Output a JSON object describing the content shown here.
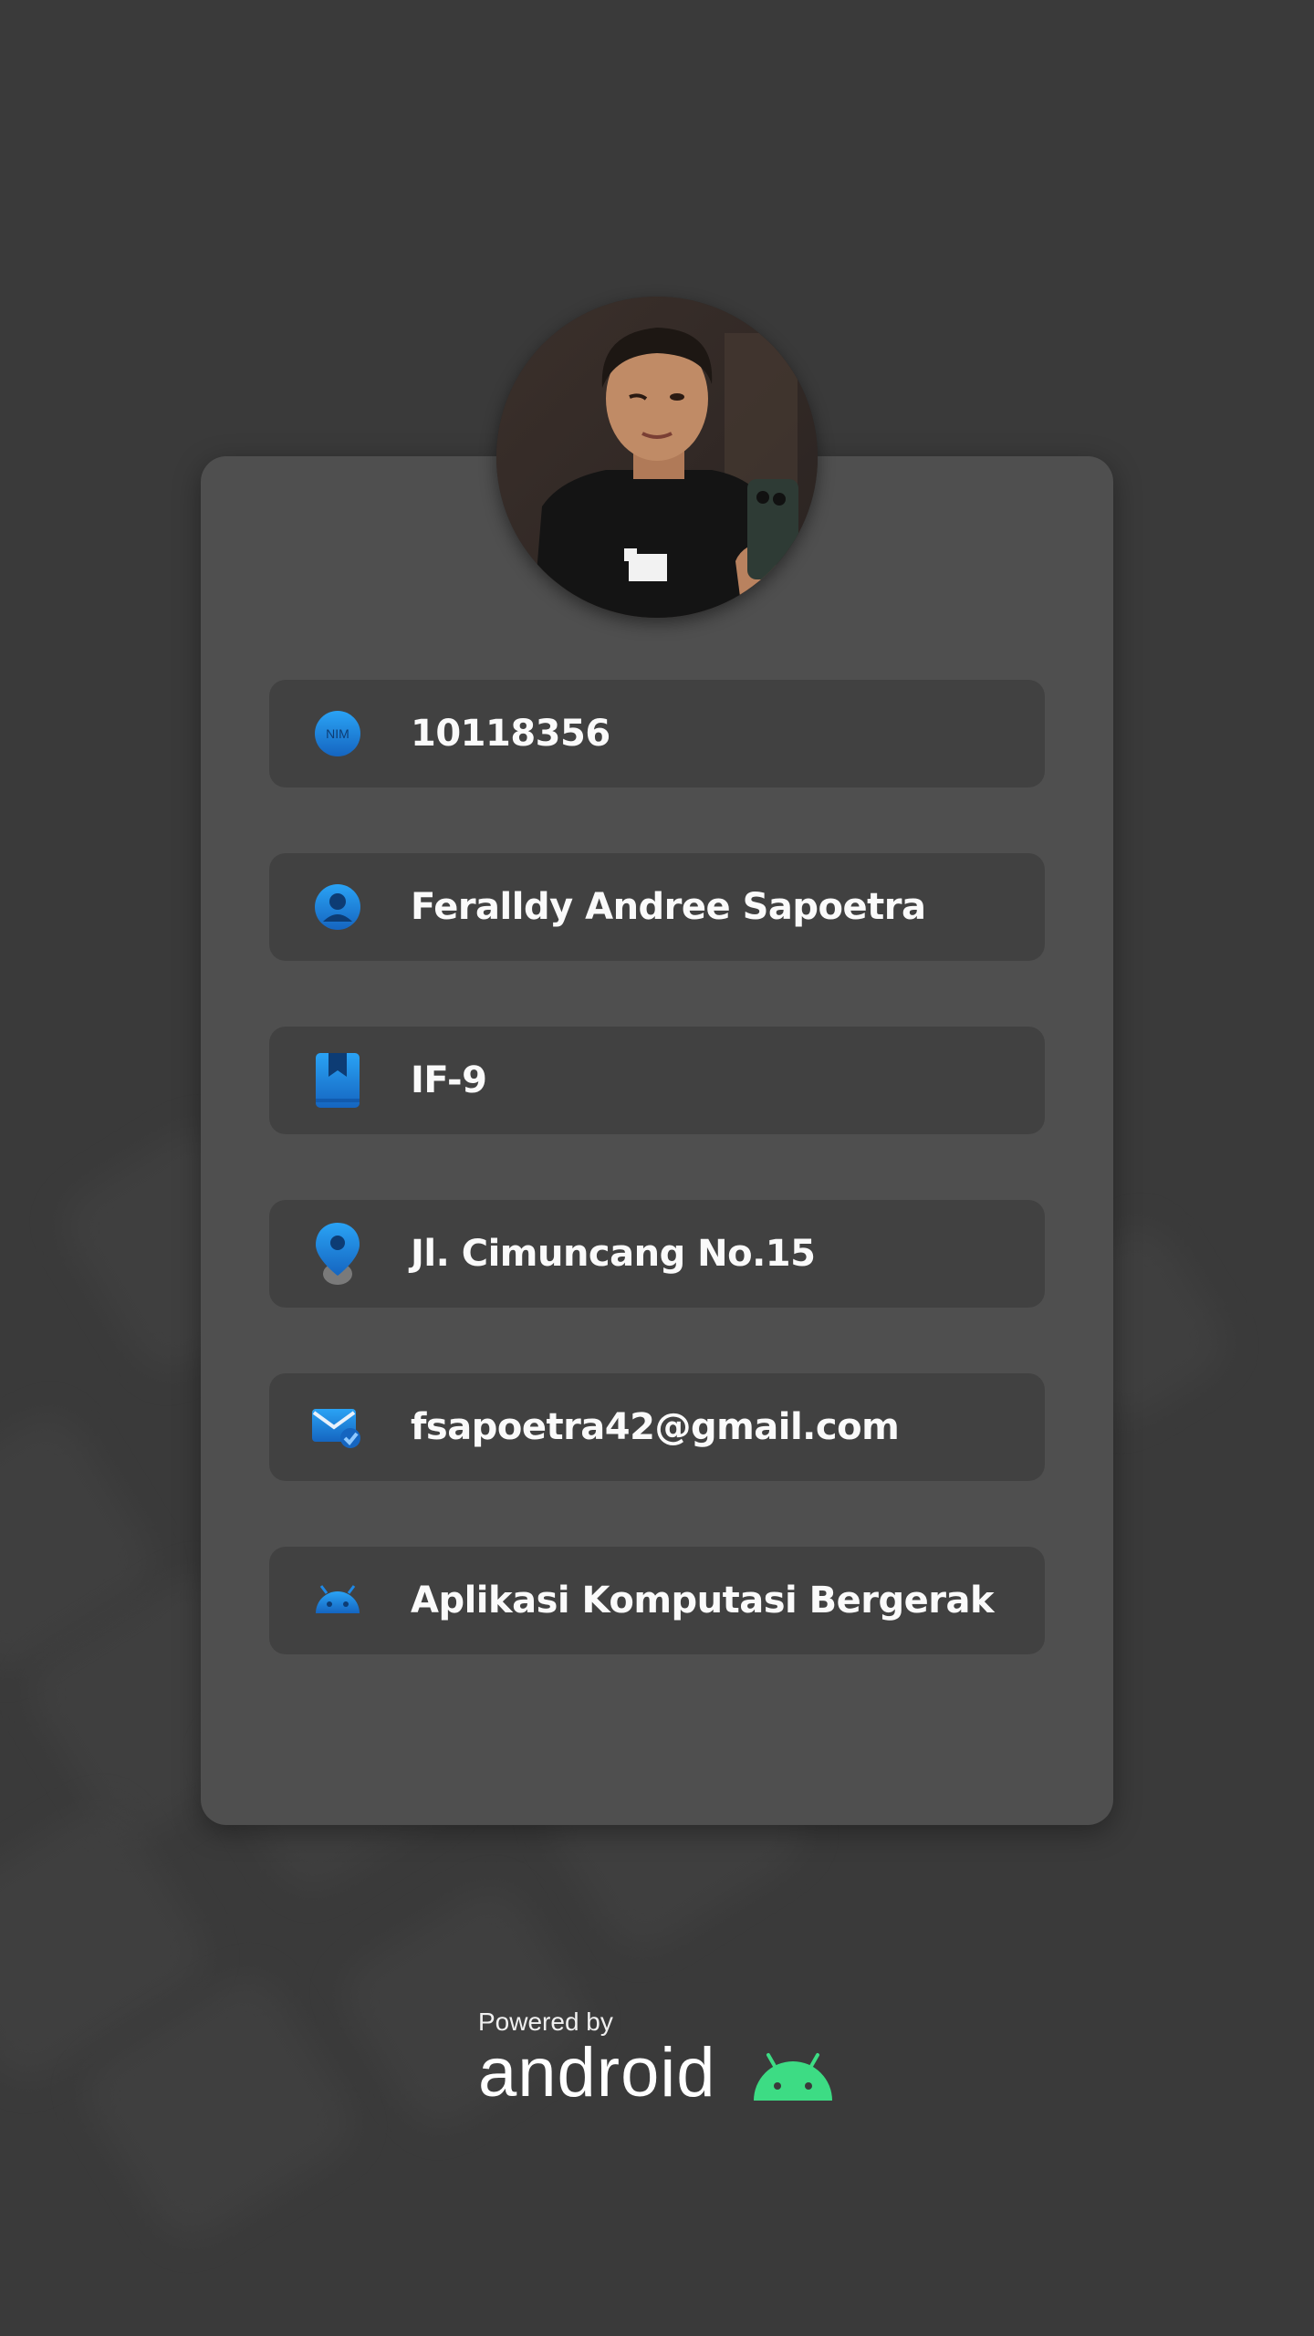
{
  "profile": {
    "avatar_alt": "profile photo",
    "fields": [
      {
        "icon": "nim-icon",
        "value": "10118356"
      },
      {
        "icon": "person-icon",
        "value": "Feralldy Andree Sapoetra"
      },
      {
        "icon": "bookmark-book-icon",
        "value": "IF-9"
      },
      {
        "icon": "location-pin-icon",
        "value": "Jl. Cimuncang No.15"
      },
      {
        "icon": "email-verified-icon",
        "value": "fsapoetra42@gmail.com"
      },
      {
        "icon": "android-icon",
        "value": "Aplikasi Komputasi Bergerak"
      }
    ],
    "nim_badge_text": "NIM"
  },
  "footer": {
    "powered_by": "Powered by",
    "brand": "android",
    "brand_color": "#3ddc84"
  },
  "colors": {
    "background": "#3a3a3a",
    "card": "#4f4f4f",
    "row": "#414141",
    "icon_blue": "#1e88e5"
  }
}
